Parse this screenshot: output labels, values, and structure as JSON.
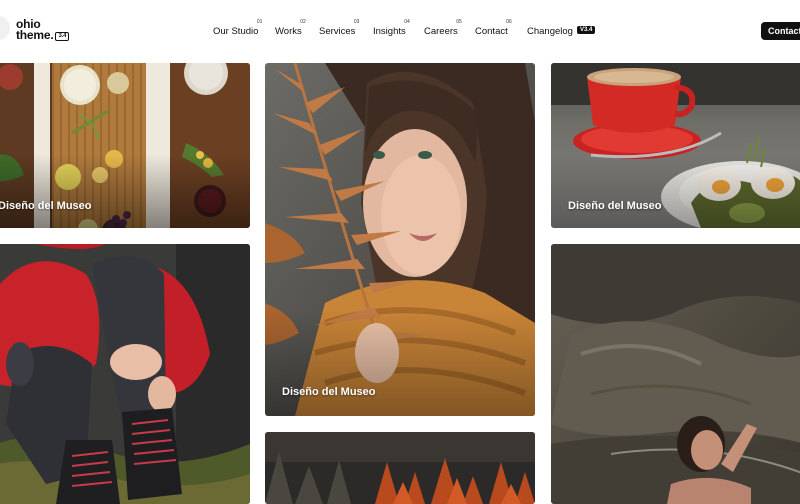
{
  "brand": {
    "name_line1": "ohio",
    "name_line2": "theme.",
    "version": "3.4"
  },
  "nav": {
    "items": [
      {
        "label": "Our Studio",
        "num": "01"
      },
      {
        "label": "Works",
        "num": "02"
      },
      {
        "label": "Services",
        "num": "03"
      },
      {
        "label": "Insights",
        "num": "04"
      },
      {
        "label": "Careers",
        "num": "05"
      },
      {
        "label": "Contact",
        "num": "06"
      }
    ],
    "changelog": {
      "label": "Changelog",
      "badge": "V3.4"
    },
    "cta_label": "Contact"
  },
  "portfolio": {
    "tiles": [
      {
        "caption": "Diseño del Museo",
        "image": "food-table-flatlay"
      },
      {
        "caption": "Diseño del Museo",
        "image": "woman-with-fern"
      },
      {
        "caption": "Diseño del Museo",
        "image": "coffee-and-breakfast"
      },
      {
        "caption": "",
        "image": "hiker-boots-sitting"
      },
      {
        "caption": "",
        "image": "rock-cliff-bather"
      },
      {
        "caption": "",
        "image": "autumn-forest"
      }
    ]
  },
  "colors": {
    "brand_dark": "#111111",
    "background": "#ffffff",
    "caption_text": "#ffffff"
  }
}
